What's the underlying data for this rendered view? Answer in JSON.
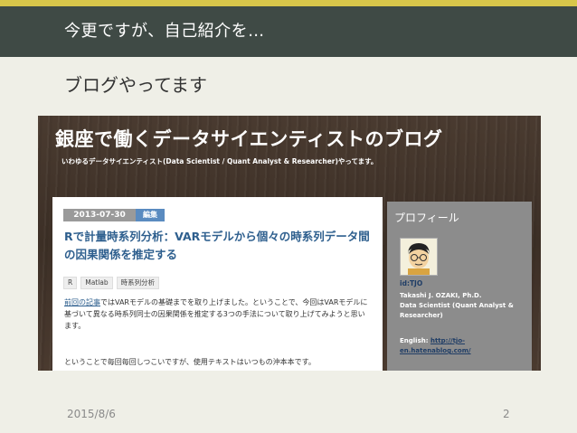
{
  "slide": {
    "header_title": "今更ですが、自己紹介を…",
    "subtitle": "ブログやってます",
    "footer_date": "2015/8/6",
    "page_number": "2"
  },
  "blog": {
    "title": "銀座で働くデータサイエンティストのブログ",
    "description": "いわゆるデータサイエンティスト(Data Scientist / Quant Analyst & Researcher)やってます。",
    "post": {
      "date": "2013-07-30",
      "edit_label": "編集",
      "title": "Rで計量時系列分析：VARモデルから個々の時系列データ間の因果関係を推定する",
      "tags": [
        "R",
        "Matlab",
        "時系列分析"
      ],
      "body_link": "前回の記事",
      "body_rest": "ではVARモデルの基礎までを取り上げました。ということで、今回はVARモデルに基づいて異なる時系列同士の因果関係を推定する3つの手法について取り上げてみようと思います。",
      "body_2": "ということで毎回毎回しつこいですが、使用テキストはいつもの沖本本です。"
    },
    "profile": {
      "heading": "プロフィール",
      "id": "id:TJO",
      "name": "Takashi J. OZAKI, Ph.D.",
      "role": "Data Scientist (Quant Analyst & Researcher)",
      "english_label": "English: ",
      "english_link": "http://tjo-en.hatenablog.com/"
    }
  },
  "colors": {
    "accent": "#d8c64a",
    "header_bg": "#3f4a45",
    "slide_bg": "#efefe7",
    "link": "#2e5f8e"
  }
}
